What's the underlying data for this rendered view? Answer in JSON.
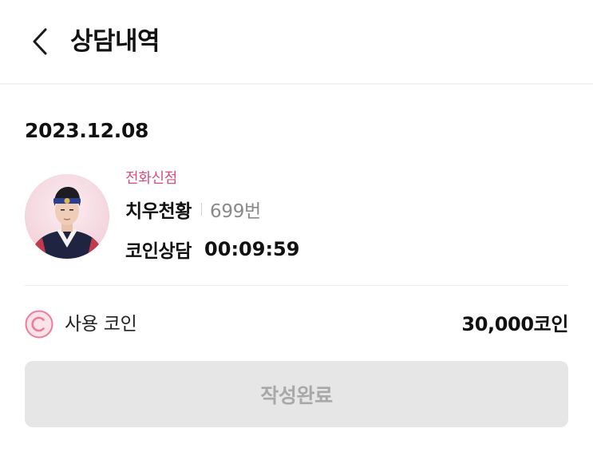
{
  "header": {
    "title": "상담내역",
    "back_icon": "chevron-left-icon"
  },
  "consultation": {
    "date": "2023.12.08",
    "category": "전화신점",
    "counselor_name": "치우천황",
    "counselor_number": "699번",
    "session_type": "코인상담",
    "duration": "00:09:59"
  },
  "coins": {
    "icon": "coin-c-icon",
    "label": "사용 코인",
    "amount": "30,000코인"
  },
  "actions": {
    "complete_label": "작성완료"
  },
  "colors": {
    "accent_pink": "#d94f7a",
    "coin_icon_pink": "#ef7b9c",
    "button_disabled_bg": "#e6e6e6",
    "button_disabled_text": "#a8a8a8"
  }
}
